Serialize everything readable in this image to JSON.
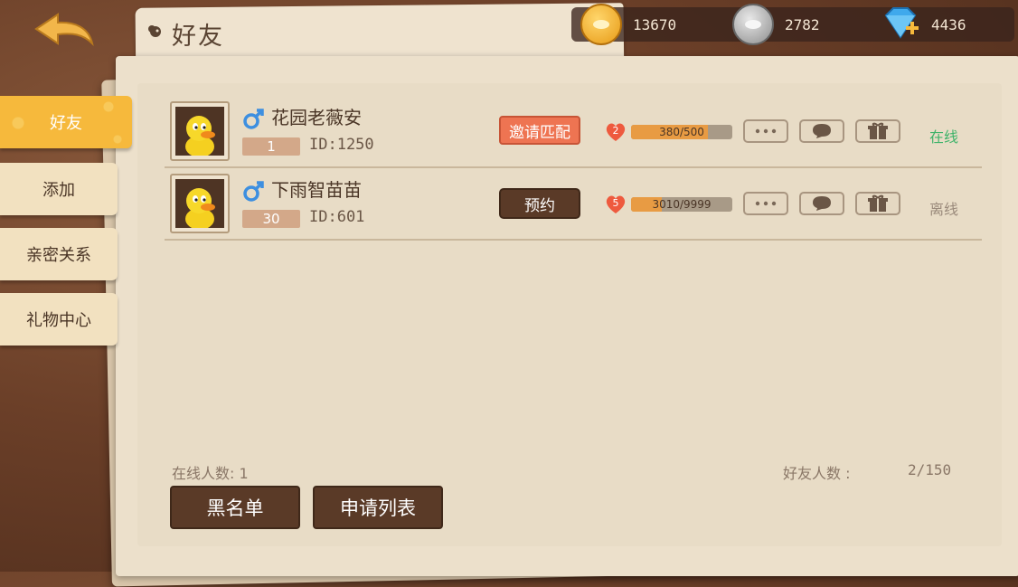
{
  "title": "好友",
  "currency": {
    "gold": "13670",
    "silver": "2782",
    "diamond": "4436"
  },
  "sidebar": {
    "items": [
      {
        "label": "好友"
      },
      {
        "label": "添加"
      },
      {
        "label": "亲密关系"
      },
      {
        "label": "礼物中心"
      }
    ]
  },
  "friends": [
    {
      "name": "花园老薇安",
      "level": "1",
      "id": "ID:1250",
      "action_label": "邀请匹配",
      "intimacy_level": "2",
      "intimacy": "380/500",
      "intimacy_fraction": 0.76,
      "status": "在线"
    },
    {
      "name": "下雨智苗苗",
      "level": "30",
      "id": "ID:601",
      "action_label": "预约",
      "intimacy_level": "5",
      "intimacy": "3010/9999",
      "intimacy_fraction": 0.301,
      "status": "离线"
    }
  ],
  "footer": {
    "online_count": "在线人数: 1",
    "friend_count_label": "好友人数 :",
    "friend_count": "2/150",
    "blacklist_label": "黑名单",
    "requests_label": "申请列表"
  },
  "colors": {
    "online": "#3fb36a",
    "offline": "#9a8a7b",
    "accent": "#f6b93c"
  }
}
